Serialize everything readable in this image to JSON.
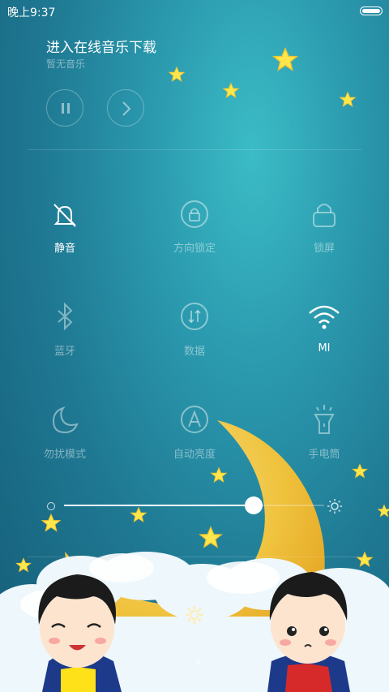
{
  "status_bar": {
    "time": "晚上9:37"
  },
  "music": {
    "title": "进入在线音乐下载",
    "subtitle": "暂无音乐"
  },
  "toggles": [
    {
      "label": "静音",
      "icon": "silent-bell-icon",
      "active": true
    },
    {
      "label": "方向锁定",
      "icon": "rotation-lock-icon",
      "active": false
    },
    {
      "label": "锁屏",
      "icon": "lock-icon",
      "active": false
    },
    {
      "label": "蓝牙",
      "icon": "bluetooth-icon",
      "active": false
    },
    {
      "label": "数据",
      "icon": "mobile-data-icon",
      "active": false
    },
    {
      "label": "MI",
      "icon": "wifi-icon",
      "active": true
    },
    {
      "label": "勿扰模式",
      "icon": "moon-icon",
      "active": false
    },
    {
      "label": "自动亮度",
      "icon": "auto-brightness-icon",
      "active": false
    },
    {
      "label": "手电筒",
      "icon": "flashlight-icon",
      "active": false
    }
  ],
  "brightness": {
    "level": 0.73
  },
  "colors": {
    "accent": "#ffffff",
    "background": "#1f7892",
    "moon": "#f6c53b"
  }
}
